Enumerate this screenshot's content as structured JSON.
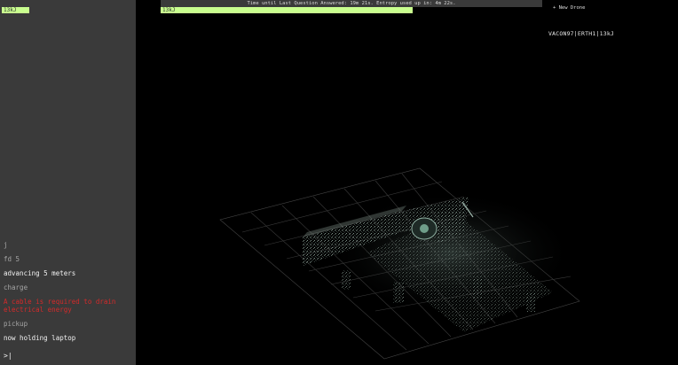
{
  "sidebar": {
    "energy_label": "13kJ",
    "log": [
      {
        "kind": "cmd",
        "text": "j"
      },
      {
        "kind": "cmd",
        "text": "fd 5"
      },
      {
        "kind": "out",
        "text": "advancing 5 meters"
      },
      {
        "kind": "cmd",
        "text": "charge"
      },
      {
        "kind": "err",
        "text": "A cable is required to drain electrical energy"
      },
      {
        "kind": "cmd",
        "text": "pickup"
      },
      {
        "kind": "out",
        "text": "now holding laptop"
      }
    ],
    "prompt": ">"
  },
  "main": {
    "topbar_text": "Time until Last Question Answered: 19m 21s. Entropy used up in: 4m 22s.",
    "energy_label": "13kJ",
    "energy_fraction": 0.66,
    "new_drone_label": "+ New Drone",
    "status_text": "VACON97|ERTH1|13kJ"
  },
  "colors": {
    "energy_bar": "#c9ff8f",
    "sidebar_bg": "#3a3a3a",
    "error_text": "#d42a2a"
  }
}
